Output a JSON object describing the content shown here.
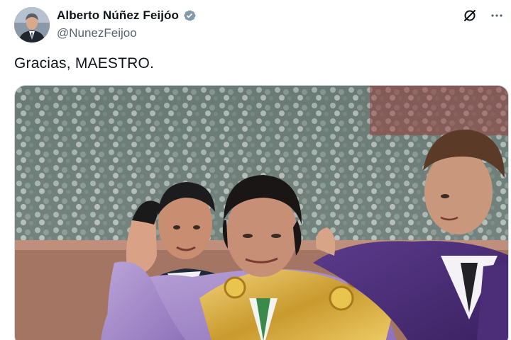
{
  "author": {
    "display_name": "Alberto Núñez Feijóo",
    "handle": "@NunezFeijoo",
    "verified_icon": "verified-badge-icon",
    "verified_color": "#829aab"
  },
  "actions": {
    "grok_icon": "grok-icon",
    "more_icon": "more-icon"
  },
  "tweet": {
    "text": "Gracias, MAESTRO."
  },
  "media": {
    "type": "photo"
  },
  "colors": {
    "text": "#0f1419",
    "secondary": "#536471",
    "border": "#cfd9de"
  }
}
